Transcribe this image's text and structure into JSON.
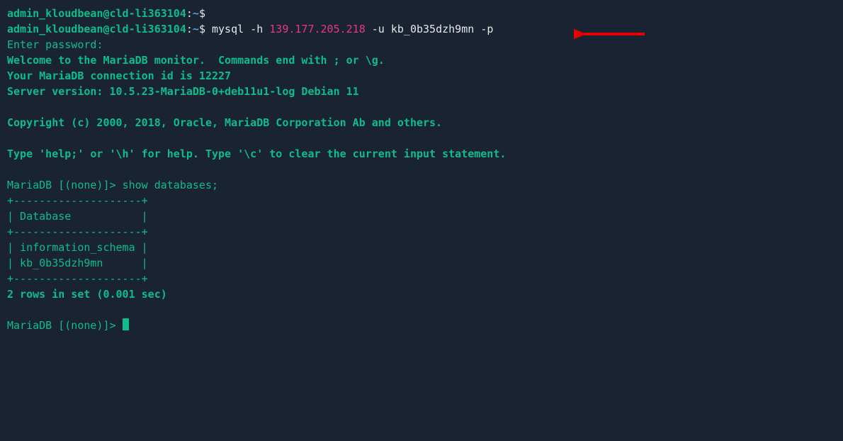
{
  "prompt1": {
    "user": "admin_kloudbean",
    "at": "@",
    "host": "cld-li363104",
    "colon": ":",
    "path": "~",
    "dollar": "$"
  },
  "prompt2": {
    "user": "admin_kloudbean",
    "at": "@",
    "host": "cld-li363104",
    "colon": ":",
    "path": "~",
    "dollar": "$",
    "cmd_mysql": " mysql ",
    "flag_h": "-h",
    "space1": " ",
    "ip": "139.177.205.218",
    "space2": " ",
    "flag_u": "-u",
    "user_arg": " kb_0b35dzh9mn ",
    "flag_p": "-p"
  },
  "enter_password": "Enter password:",
  "welcome1": "Welcome to the MariaDB monitor.  Commands end with ; or \\g.",
  "welcome2": "Your MariaDB connection id is 12227",
  "welcome3": "Server version: 10.5.23-MariaDB-0+deb11u1-log Debian 11",
  "copyright": "Copyright (c) 2000, 2018, Oracle, MariaDB Corporation Ab and others.",
  "help_line": "Type 'help;' or '\\h' for help. Type '\\c' to clear the current input statement.",
  "mariadb_prompt": "MariaDB [(none)]> ",
  "show_databases": "show databases;",
  "table_border": "+--------------------+",
  "table_header": "| Database           |",
  "row1": "| information_schema |",
  "row2": "| kb_0b35dzh9mn      |",
  "rows_summary": "2 rows in set (0.001 sec)",
  "blank": " "
}
